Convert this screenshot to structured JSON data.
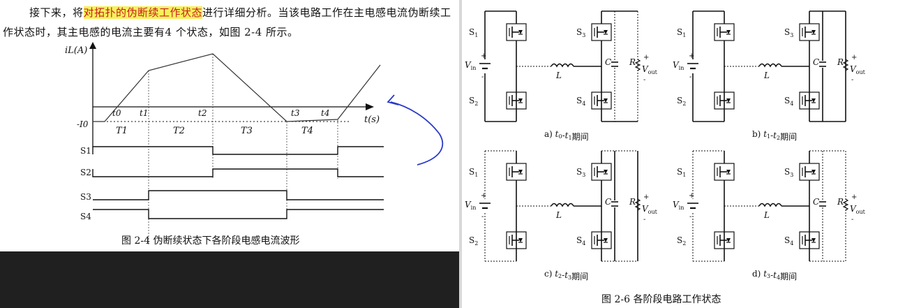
{
  "left": {
    "paragraph": {
      "before": "接下来，将",
      "highlight": "对拓扑的伪断续工作状态",
      "after1": "进行详细分析。当该电路工作在主电感电流伪断续工作状态时，其主电感的电流主要有",
      "underlined": "4 个状态",
      "after2": "，如图 2-4 所示。"
    },
    "figure": {
      "y_axis_label": "iL(A)",
      "x_axis_label": "t(s)",
      "neg_label": "-I0",
      "time_marks": [
        "t0",
        "t1",
        "t2",
        "t3",
        "t4"
      ],
      "intervals": [
        "T1",
        "T2",
        "T3",
        "T4"
      ],
      "signals": [
        "S1",
        "S2",
        "S3",
        "S4"
      ],
      "caption": "图 2-4 伪断续状态下各阶段电感电流波形"
    },
    "colors": {
      "highlight_bg": "#f6f05a",
      "highlight_text": "#c81e1e",
      "pen_ink": "#2a3ac8",
      "dark_strip": "#202020"
    }
  },
  "right": {
    "panels": [
      {
        "caption_prefix": "a) ",
        "t_from": "t0",
        "t_to": "t1",
        "caption_suffix": "期间"
      },
      {
        "caption_prefix": "b) ",
        "t_from": "t1",
        "t_to": "t2",
        "caption_suffix": "期间"
      },
      {
        "caption_prefix": "c) ",
        "t_from": "t2",
        "t_to": "t3",
        "caption_suffix": "期间"
      },
      {
        "caption_prefix": "d) ",
        "t_from": "t3",
        "t_to": "t4",
        "caption_suffix": "期间"
      }
    ],
    "labels": {
      "s1": "S1",
      "s2": "S2",
      "s3": "S3",
      "s4": "S4",
      "vin": "Vin",
      "vout": "Vout",
      "L": "L",
      "C": "C",
      "R": "R"
    },
    "caption": "图 2-6  各阶段电路工作状态"
  }
}
